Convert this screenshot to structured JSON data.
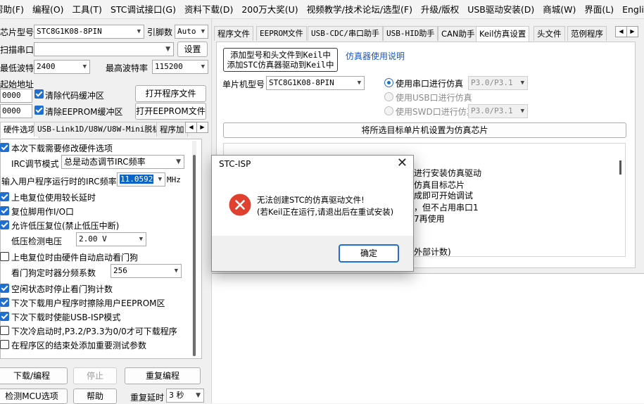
{
  "menu": [
    "帮助(F)",
    "编程(O)",
    "工具(T)",
    "STC调试接口(G)",
    "资料下载(D)",
    "200万大奖(U)",
    "视频教学/技术论坛/选型(F)",
    "升级/版权",
    "USB驱动安装(D)",
    "商城(W)",
    "界面(L)",
    "English"
  ],
  "left": {
    "chip_label": "芯片型号",
    "chip_value": "STC8G1K08-8PIN",
    "pins_label": "引脚数",
    "pins_value": "Auto",
    "port_label": "扫描串口",
    "port_value": "",
    "settings_btn": "设置",
    "min_baud_label": "最低波特率",
    "min_baud_value": "2400",
    "max_baud_label": "最高波特率",
    "max_baud_value": "115200",
    "start_addr_label": "起始地址",
    "addr1_value": "0000",
    "clear_code_label": "清除代码缓冲区",
    "open_prog_btn": "打开程序文件",
    "addr2_value": "0000",
    "clear_eeprom_label": "清除EEPROM缓冲区",
    "open_eeprom_btn": "打开EEPROM文件",
    "tabs": [
      "硬件选项",
      "USB-Link1D/U8W/U8W-Mini脱机",
      "程序加"
    ],
    "options": {
      "modify_hw": "本次下载需要修改硬件选项",
      "irc_mode_label": "IRC调节模式",
      "irc_mode_value": "总是动态调节IRC频率",
      "irc_freq_label": "输入用户程序运行时的IRC频率",
      "irc_freq_value": "11.0592",
      "irc_unit": "MHz",
      "long_delay": "上电复位使用较长延时",
      "reset_pin": "复位脚用作I/O口",
      "low_volt_reset": "允许低压复位(禁止低压中断)",
      "low_volt_label": "低压检测电压",
      "low_volt_value": "2.00 V",
      "wdt_auto": "上电复位时由硬件自动启动看门狗",
      "wdt_div_label": "看门狗定时器分频系数",
      "wdt_div_value": "256",
      "idle_stop_wdt": "空闲状态时停止看门狗计数",
      "erase_eeprom": "下次下载用户程序时擦除用户EEPROM区",
      "usb_isp": "下次下载时使能USB-ISP模式",
      "cold_boot": "下次冷启动时,P3.2/P3.3为0/0才可下载程序",
      "add_params": "在程序区的结束处添加重要测试参数"
    },
    "download_btn": "下载/编程",
    "stop_btn": "停止",
    "reprog_btn": "重复编程",
    "detect_btn": "检测MCU选项",
    "help_btn": "帮助",
    "repeat_delay_label": "重复延时",
    "repeat_delay_value": "3 秒"
  },
  "right": {
    "tabs": [
      "程序文件",
      "EEPROM文件",
      "USB-CDC/串口助手",
      "USB-HID助手",
      "CAN助手",
      "Keil仿真设置",
      "头文件",
      "范例程序"
    ],
    "add_keil_btn_line1": "添加型号和头文件到Keil中",
    "add_keil_btn_line2": "添加STC仿真器驱动到Keil中",
    "emu_help_link": "仿真器使用说明",
    "mcu_label": "单片机型号",
    "mcu_value": "STC8G1K08-8PIN",
    "radio_serial": "使用串口进行仿真",
    "radio_serial_port": "P3.0/P3.1",
    "radio_usb": "使用USB口进行仿真",
    "radio_swd": "使用SWD口进行仿真",
    "radio_swd_port": "P3.0/P3.1",
    "set_chip_btn": "将所选目标单片机设置为仿真芯片",
    "instructions": [
      "进行安装仿真驱动",
      "仿真目标芯片",
      "成即可开始调试",
      "，但不占用串口1",
      "7再使用",
      "外部计数)"
    ]
  },
  "dialog": {
    "title": "STC-ISP",
    "close": "✕",
    "message_line1": "无法创建STC的仿真驱动文件!",
    "message_line2": "(若Keil正在运行,请退出后在重试安装)",
    "ok": "确定",
    "error_color": "#e0402f"
  }
}
